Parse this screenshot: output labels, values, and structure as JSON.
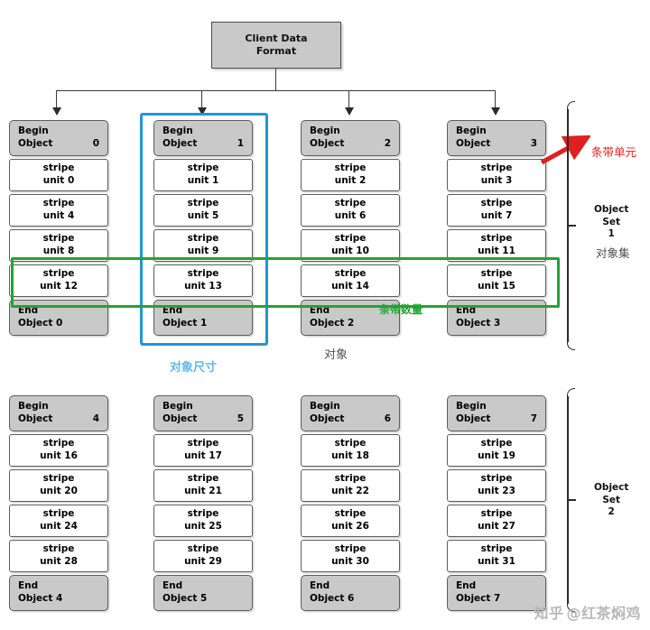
{
  "title": "Client Data Format",
  "root": {
    "label": "Client Data\nFormat",
    "line1": "Client Data",
    "line2": "Format"
  },
  "object_sets": [
    {
      "name": "Object Set 1",
      "label_line1": "Object",
      "label_line2": "Set",
      "label_line3": "1",
      "annotation_cn": "对象集",
      "columns": [
        {
          "begin_label": "Begin",
          "begin_object_word": "Object",
          "begin_number": "0",
          "end_label": "End",
          "end_text": "End\nObject 0",
          "end_line1": "End",
          "end_line2": "Object 0",
          "units": [
            {
              "line1": "stripe",
              "line2": "unit 0"
            },
            {
              "line1": "stripe",
              "line2": "unit 4"
            },
            {
              "line1": "stripe",
              "line2": "unit 8"
            },
            {
              "line1": "stripe",
              "line2": "unit 12"
            }
          ]
        },
        {
          "begin_label": "Begin",
          "begin_object_word": "Object",
          "begin_number": "1",
          "end_label": "End",
          "end_text": "End\nObject 1",
          "end_line1": "End",
          "end_line2": "Object 1",
          "units": [
            {
              "line1": "stripe",
              "line2": "unit 1"
            },
            {
              "line1": "stripe",
              "line2": "unit 5"
            },
            {
              "line1": "stripe",
              "line2": "unit 9"
            },
            {
              "line1": "stripe",
              "line2": "unit 13"
            }
          ]
        },
        {
          "begin_label": "Begin",
          "begin_object_word": "Object",
          "begin_number": "2",
          "end_label": "End",
          "end_text": "End\nObject 2",
          "end_line1": "End",
          "end_line2": "Object 2",
          "units": [
            {
              "line1": "stripe",
              "line2": "unit 2"
            },
            {
              "line1": "stripe",
              "line2": "unit 6"
            },
            {
              "line1": "stripe",
              "line2": "unit 10"
            },
            {
              "line1": "stripe",
              "line2": "unit 14"
            }
          ]
        },
        {
          "begin_label": "Begin",
          "begin_object_word": "Object",
          "begin_number": "3",
          "end_label": "End",
          "end_text": "End\nObject 3",
          "end_line1": "End",
          "end_line2": "Object 3",
          "units": [
            {
              "line1": "stripe",
              "line2": "unit 3"
            },
            {
              "line1": "stripe",
              "line2": "unit 7"
            },
            {
              "line1": "stripe",
              "line2": "unit 11"
            },
            {
              "line1": "stripe",
              "line2": "unit 15"
            }
          ]
        }
      ]
    },
    {
      "name": "Object Set 2",
      "label_line1": "Object",
      "label_line2": "Set",
      "label_line3": "2",
      "columns": [
        {
          "begin_label": "Begin",
          "begin_object_word": "Object",
          "begin_number": "4",
          "end_label": "End",
          "end_line1": "End",
          "end_line2": "Object 4",
          "units": [
            {
              "line1": "stripe",
              "line2": "unit 16"
            },
            {
              "line1": "stripe",
              "line2": "unit 20"
            },
            {
              "line1": "stripe",
              "line2": "unit 24"
            },
            {
              "line1": "stripe",
              "line2": "unit 28"
            }
          ]
        },
        {
          "begin_label": "Begin",
          "begin_object_word": "Object",
          "begin_number": "5",
          "end_label": "End",
          "end_line1": "End",
          "end_line2": "Object 5",
          "units": [
            {
              "line1": "stripe",
              "line2": "unit 17"
            },
            {
              "line1": "stripe",
              "line2": "unit 21"
            },
            {
              "line1": "stripe",
              "line2": "unit 25"
            },
            {
              "line1": "stripe",
              "line2": "unit 29"
            }
          ]
        },
        {
          "begin_label": "Begin",
          "begin_object_word": "Object",
          "begin_number": "6",
          "end_label": "End",
          "end_line1": "End",
          "end_line2": "Object 6",
          "units": [
            {
              "line1": "stripe",
              "line2": "unit 18"
            },
            {
              "line1": "stripe",
              "line2": "unit 22"
            },
            {
              "line1": "stripe",
              "line2": "unit 26"
            },
            {
              "line1": "stripe",
              "line2": "unit 30"
            }
          ]
        },
        {
          "begin_label": "Begin",
          "begin_object_word": "Object",
          "begin_number": "7",
          "end_label": "End",
          "end_line1": "End",
          "end_line2": "Object 7",
          "units": [
            {
              "line1": "stripe",
              "line2": "unit 19"
            },
            {
              "line1": "stripe",
              "line2": "unit 23"
            },
            {
              "line1": "stripe",
              "line2": "unit 27"
            },
            {
              "line1": "stripe",
              "line2": "unit 31"
            }
          ]
        }
      ]
    }
  ],
  "annotations": {
    "stripe_unit_cn": "条带单元",
    "stripe_count_cn": "条带数量",
    "object_size_cn": "对象尺寸",
    "object_cn": "对象",
    "object_set_cn": "对象集"
  },
  "colors": {
    "blue_highlight": "#2196d6",
    "blue_label": "#62b8e8",
    "green_highlight": "#21a531",
    "red_arrow": "#e02020",
    "header_fill": "#c9c9c9",
    "cell_fill": "#ffffff",
    "border": "#5d5d5d"
  },
  "watermark": {
    "site": "知乎",
    "handle": "@红茶焖鸡"
  }
}
